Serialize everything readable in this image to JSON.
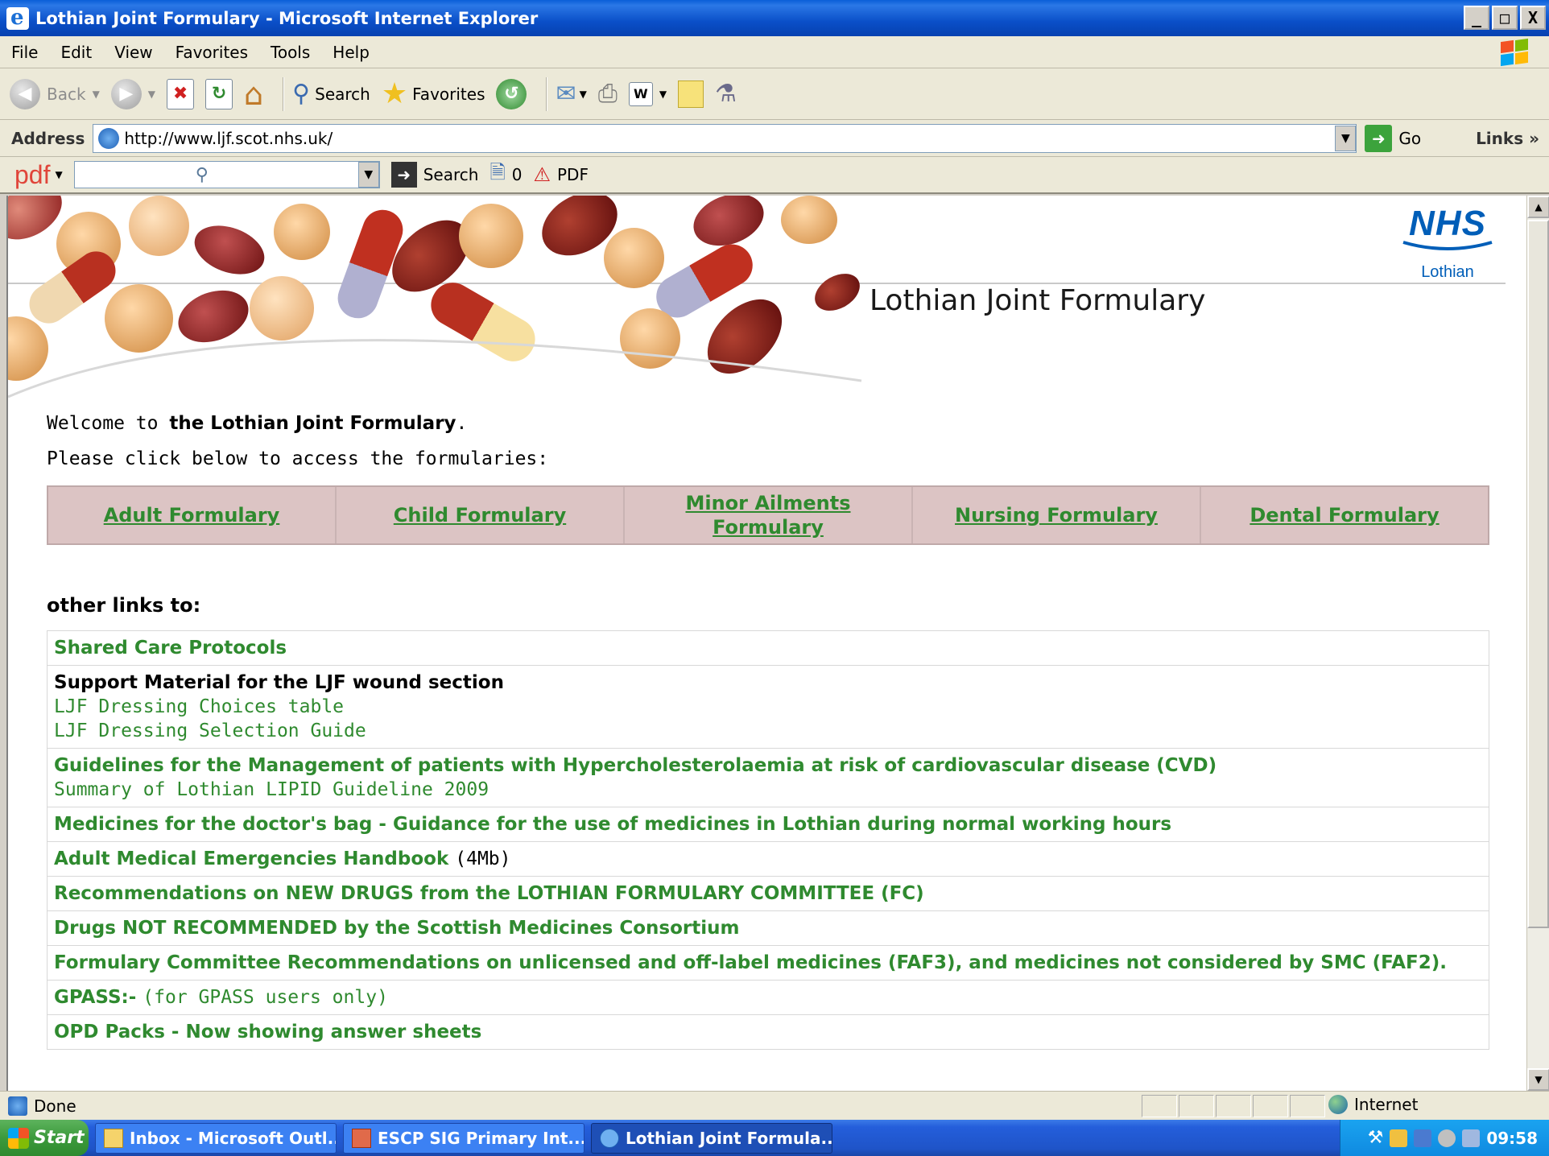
{
  "window": {
    "title": "Lothian Joint Formulary - Microsoft Internet Explorer",
    "buttons": {
      "minimize": "_",
      "maximize": "□",
      "close": "X"
    }
  },
  "menu": [
    "File",
    "Edit",
    "View",
    "Favorites",
    "Tools",
    "Help"
  ],
  "toolbar": {
    "back": "Back",
    "search": "Search",
    "favorites": "Favorites"
  },
  "address": {
    "label": "Address",
    "url": "http://www.ljf.scot.nhs.uk/",
    "go": "Go",
    "links": "Links"
  },
  "pdfbar": {
    "logo": "pdf",
    "search_label": "Search",
    "count": "0",
    "pdf_label": "PDF"
  },
  "header": {
    "nhs": "NHS",
    "region": "Lothian",
    "site_title": "Lothian Joint Formulary"
  },
  "intro": {
    "welcome_prefix": "Welcome to ",
    "welcome_bold": "the Lothian Joint Formulary",
    "welcome_suffix": ".",
    "instruction": "Please click below to access the formularies:"
  },
  "formularies": [
    {
      "label": "Adult Formulary"
    },
    {
      "label": "Child Formulary"
    },
    {
      "label": "Minor Ailments Formulary"
    },
    {
      "label": "Nursing Formulary"
    },
    {
      "label": "Dental Formulary"
    }
  ],
  "other_links": {
    "heading": "other links to:",
    "shared_care": "Shared Care Protocols",
    "wound_heading": "Support Material for the LJF wound section",
    "wound_sub1": "LJF Dressing Choices table",
    "wound_sub2": "LJF Dressing Selection Guide",
    "lipid_main": "Guidelines for the Management of patients with Hypercholesterolaemia at risk of cardiovascular disease (CVD)",
    "lipid_sub": "Summary of Lothian LIPID Guideline 2009",
    "doctors_bag": "Medicines for the doctor's bag - Guidance for the use of medicines in Lothian during normal working hours",
    "emergencies_main": "Adult Medical Emergencies Handbook",
    "emergencies_size": "(4Mb)",
    "new_drugs": "Recommendations on NEW DRUGS from the LOTHIAN FORMULARY COMMITTEE (FC)",
    "not_recommended": "Drugs NOT RECOMMENDED by the Scottish Medicines Consortium",
    "faf": "Formulary Committee Recommendations on unlicensed and off-label medicines (FAF3), and medicines not considered by SMC (FAF2).",
    "gpass_main": "GPASS:-",
    "gpass_sub": "(for GPASS users only)",
    "cropped": "OPD Packs - Now showing answer sheets"
  },
  "status": {
    "text": "Done",
    "zone": "Internet"
  },
  "taskbar": {
    "start": "Start",
    "tasks": [
      "Inbox - Microsoft Outl...",
      "ESCP SIG Primary Int...",
      "Lothian Joint Formula..."
    ],
    "clock": "09:58"
  },
  "colors": {
    "link_green": "#2f8a2f",
    "nhs_blue": "#005eb8",
    "formulary_bg": "#dcc4c4",
    "titlebar_blue": "#0a4fc8"
  }
}
